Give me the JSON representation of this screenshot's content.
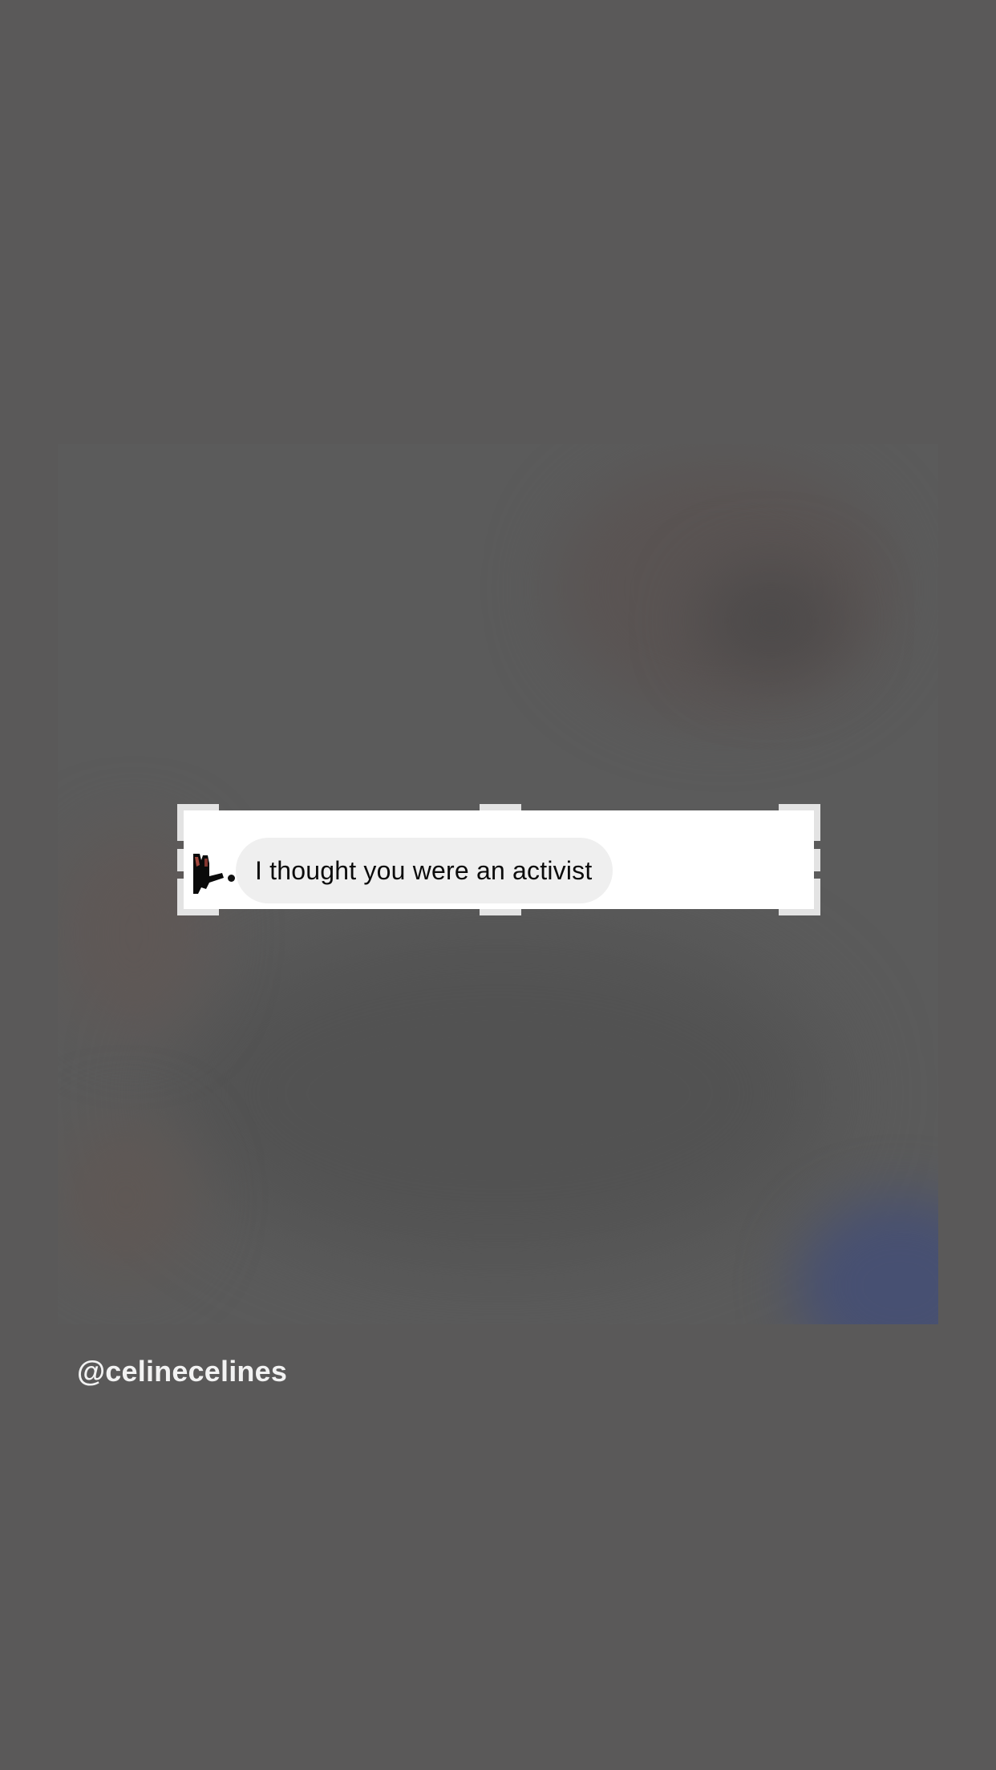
{
  "story": {
    "message_text": "I thought you were an activist",
    "username": "@celinecelines",
    "colors": {
      "background": "#5a5959",
      "message_bubble": "#efefef",
      "crop_handles": "#e3e3e3"
    },
    "icons": {
      "avatar": "redacted-avatar-icon",
      "read_indicator": "dot-icon"
    }
  }
}
